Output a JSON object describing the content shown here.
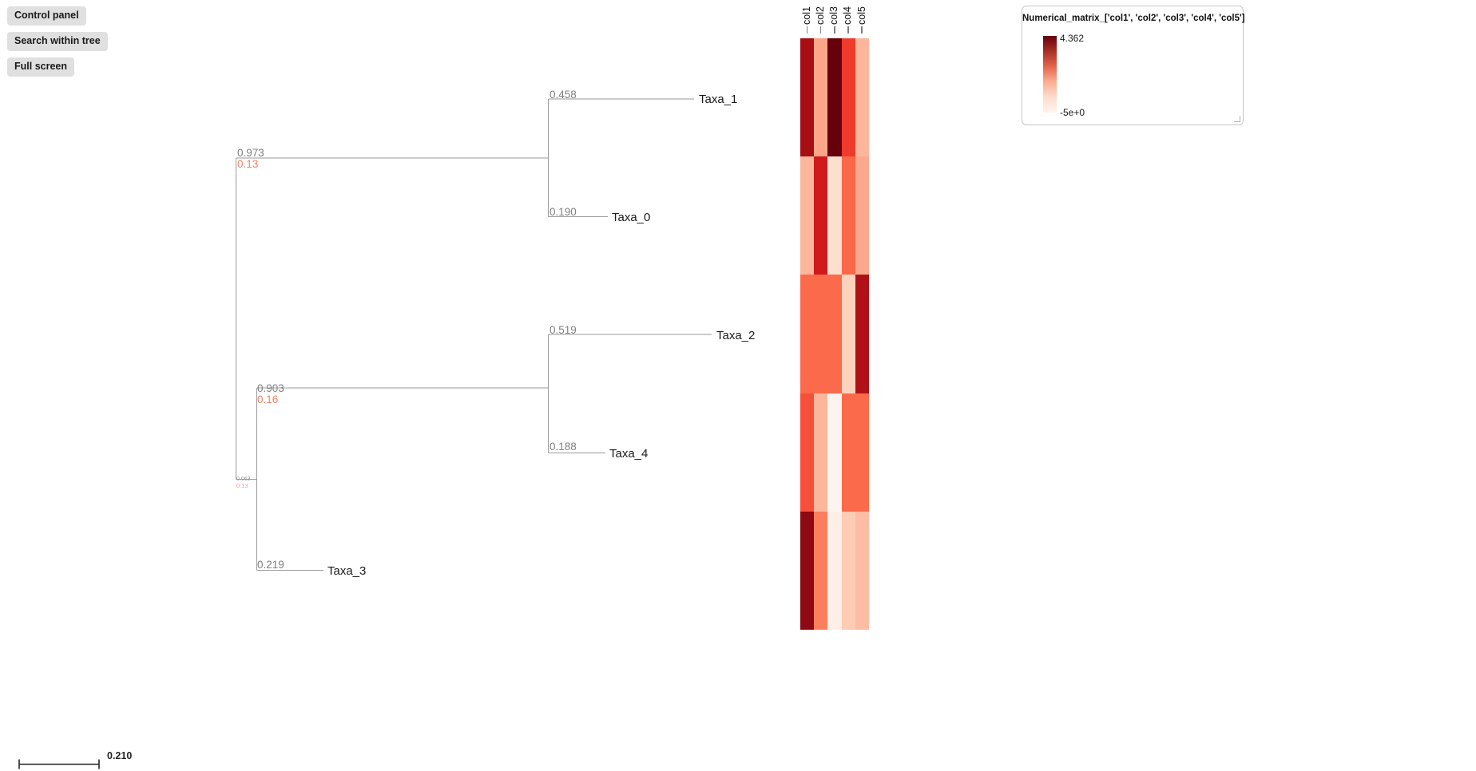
{
  "toolbar": {
    "buttons": [
      {
        "label": "Control panel",
        "name": "control-panel-button"
      },
      {
        "label": "Search within tree",
        "name": "search-within-tree-button"
      },
      {
        "label": "Full screen",
        "name": "full-screen-button"
      }
    ]
  },
  "tree": {
    "leaves": [
      {
        "label": "Taxa_1",
        "branch_length": "0.458"
      },
      {
        "label": "Taxa_0",
        "branch_length": "0.190"
      },
      {
        "label": "Taxa_2",
        "branch_length": "0.519"
      },
      {
        "label": "Taxa_4",
        "branch_length": "0.188"
      },
      {
        "label": "Taxa_3",
        "branch_length": "0.219"
      }
    ],
    "internal_nodes": [
      {
        "support": "0.973",
        "distance": "0.13"
      },
      {
        "support": "0.903",
        "distance": "0.16"
      },
      {
        "support": "0.063",
        "distance": "0.13"
      }
    ],
    "scale_bar": {
      "value": "0.210"
    }
  },
  "heatmap": {
    "columns": [
      "col1",
      "col2",
      "col3",
      "col4",
      "col5"
    ],
    "rows": [
      {
        "taxon": "Taxa_1",
        "colors": [
          "#a70e13",
          "#fba689",
          "#67000d",
          "#ef3b2c",
          "#fcb69b"
        ]
      },
      {
        "taxon": "Taxa_0",
        "colors": [
          "#fcb69b",
          "#cf191d",
          "#fddfd0",
          "#fa6849",
          "#fba98e"
        ]
      },
      {
        "taxon": "Taxa_2",
        "colors": [
          "#fb6a4a",
          "#fb6a4a",
          "#fb6a4a",
          "#fcd2bd",
          "#b01117"
        ]
      },
      {
        "taxon": "Taxa_4",
        "colors": [
          "#f6503a",
          "#fbb79c",
          "#fef4ef",
          "#fb6a4a",
          "#fb6a4a"
        ]
      },
      {
        "taxon": "Taxa_3",
        "colors": [
          "#8e0912",
          "#fb7f5d",
          "#fdefe8",
          "#fcccb5",
          "#fcbda4"
        ]
      }
    ]
  },
  "legend": {
    "title": "Numerical_matrix_['col1', 'col2', 'col3', 'col4', 'col5']",
    "max_value": "4.362",
    "min_value": "-5e+0",
    "gradient_high_color": "#67000d",
    "gradient_low_color": "#fff5f0"
  }
}
